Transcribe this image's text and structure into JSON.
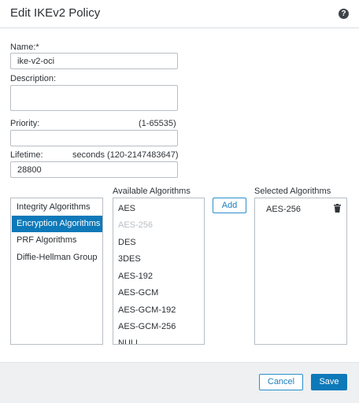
{
  "dialog": {
    "title": "Edit IKEv2 Policy",
    "help_icon": "help-icon",
    "help_glyph": "?"
  },
  "form": {
    "name_label": "Name:*",
    "name_value": "ike-v2-oci",
    "description_label": "Description:",
    "description_value": "",
    "priority_label": "Priority:",
    "priority_range": "(1-65535)",
    "priority_value": "",
    "lifetime_label": "Lifetime:",
    "lifetime_units": "seconds (120-2147483647)",
    "lifetime_value": "28800"
  },
  "categories": {
    "items": [
      {
        "label": "Integrity Algorithms",
        "selected": false
      },
      {
        "label": "Encryption Algorithms",
        "selected": true
      },
      {
        "label": "PRF Algorithms",
        "selected": false
      },
      {
        "label": "Diffie-Hellman Group",
        "selected": false
      }
    ]
  },
  "available": {
    "header": "Available Algorithms",
    "items": [
      {
        "label": "AES",
        "disabled": false
      },
      {
        "label": "AES-256",
        "disabled": true
      },
      {
        "label": "DES",
        "disabled": false
      },
      {
        "label": "3DES",
        "disabled": false
      },
      {
        "label": "AES-192",
        "disabled": false
      },
      {
        "label": "AES-GCM",
        "disabled": false
      },
      {
        "label": "AES-GCM-192",
        "disabled": false
      },
      {
        "label": "AES-GCM-256",
        "disabled": false
      },
      {
        "label": "NULL",
        "disabled": false
      }
    ]
  },
  "add_button": "Add",
  "selected": {
    "header": "Selected Algorithms",
    "items": [
      {
        "label": "AES-256",
        "icon": "trash-icon"
      }
    ]
  },
  "footer": {
    "cancel_label": "Cancel",
    "save_label": "Save"
  },
  "colors": {
    "accent": "#0e79b9",
    "disabled_text": "#b9bec3",
    "footer_bg": "#eef0f2"
  }
}
